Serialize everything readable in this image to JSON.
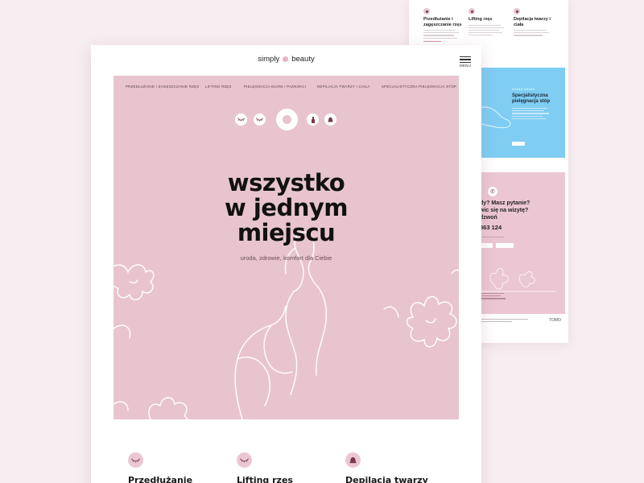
{
  "brand": {
    "left": "simply",
    "right": "beauty"
  },
  "menu": {
    "label": "MENU"
  },
  "hero_nav": [
    "PRZEDŁUŻANIE I ZAGĘSZCZANIE RZĘS",
    "LIFTING RZĘS",
    "PIELĘGNACJA DŁONI I PAZNOKCI",
    "DEPILACJA TWARZY I CIAŁA",
    "SPECJALISTYCZNA PIELĘGNACJA STÓP"
  ],
  "hero": {
    "headline": "wszystko\nw jednym\nmiejscu",
    "subline": "uroda, zdrowie, komfort dla Ciebie"
  },
  "services": [
    {
      "title": "Przedłużanie",
      "icon": "eye-closed-icon"
    },
    {
      "title": "Lifting rzęs",
      "icon": "eyelash-icon"
    },
    {
      "title": "Depilacja twarzy",
      "icon": "bell-icon"
    }
  ],
  "back_page": {
    "services": [
      {
        "title": "Przedłużanie i zagęszczanie rzęs"
      },
      {
        "title": "Lifting rzęs"
      },
      {
        "title": "Depilacja twarzy i ciała"
      }
    ],
    "blue_card": {
      "title": "Specjalistyczna pielęgnacja stóp"
    },
    "contact": {
      "title": "dy? Masz pytanie?\nwic się na wizytę?\ndzwoń",
      "phone": "363 124"
    },
    "footer_brand": "TOMO"
  },
  "colors": {
    "accent_pink": "#e8c5ce",
    "card_blue": "#7fcdf3",
    "deep_plum": "#7a3550"
  }
}
